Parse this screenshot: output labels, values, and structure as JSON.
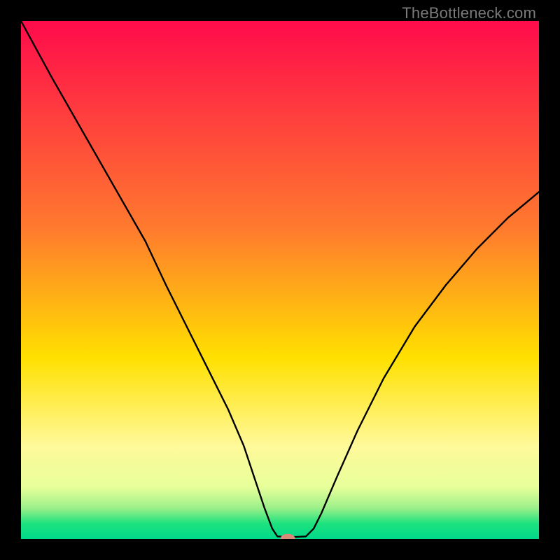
{
  "watermark": "TheBottleneck.com",
  "accent_color": "#d98b7a",
  "curve_color": "#000000",
  "chart_data": {
    "type": "line",
    "title": "",
    "xlabel": "",
    "ylabel": "",
    "xlim": [
      0,
      100
    ],
    "ylim": [
      0,
      100
    ],
    "gradient_stops": [
      {
        "offset": 0,
        "color": "#ff0b4b"
      },
      {
        "offset": 40,
        "color": "#ff7a2e"
      },
      {
        "offset": 65,
        "color": "#ffe000"
      },
      {
        "offset": 82,
        "color": "#fff99a"
      },
      {
        "offset": 90,
        "color": "#e7ff9a"
      },
      {
        "offset": 94,
        "color": "#9cf08a"
      },
      {
        "offset": 97,
        "color": "#1ee27e"
      },
      {
        "offset": 100,
        "color": "#00d88a"
      }
    ],
    "series": [
      {
        "name": "bottleneck-curve",
        "points": [
          {
            "x": 0,
            "y": 100
          },
          {
            "x": 6,
            "y": 89
          },
          {
            "x": 12,
            "y": 78.5
          },
          {
            "x": 18,
            "y": 68
          },
          {
            "x": 24,
            "y": 57.5
          },
          {
            "x": 28,
            "y": 49
          },
          {
            "x": 32,
            "y": 41
          },
          {
            "x": 36,
            "y": 33
          },
          {
            "x": 40,
            "y": 25
          },
          {
            "x": 43,
            "y": 18
          },
          {
            "x": 45,
            "y": 12
          },
          {
            "x": 47,
            "y": 6
          },
          {
            "x": 48.5,
            "y": 2
          },
          {
            "x": 49.5,
            "y": 0.5
          },
          {
            "x": 51.5,
            "y": 0.4
          },
          {
            "x": 53,
            "y": 0.4
          },
          {
            "x": 55,
            "y": 0.5
          },
          {
            "x": 56.5,
            "y": 2
          },
          {
            "x": 58,
            "y": 5
          },
          {
            "x": 61,
            "y": 12
          },
          {
            "x": 65,
            "y": 21
          },
          {
            "x": 70,
            "y": 31
          },
          {
            "x": 76,
            "y": 41
          },
          {
            "x": 82,
            "y": 49
          },
          {
            "x": 88,
            "y": 56
          },
          {
            "x": 94,
            "y": 62
          },
          {
            "x": 100,
            "y": 67
          }
        ]
      }
    ],
    "marker": {
      "x": 51.5,
      "y": 0.1,
      "rx": 1.4,
      "ry": 0.9
    }
  }
}
